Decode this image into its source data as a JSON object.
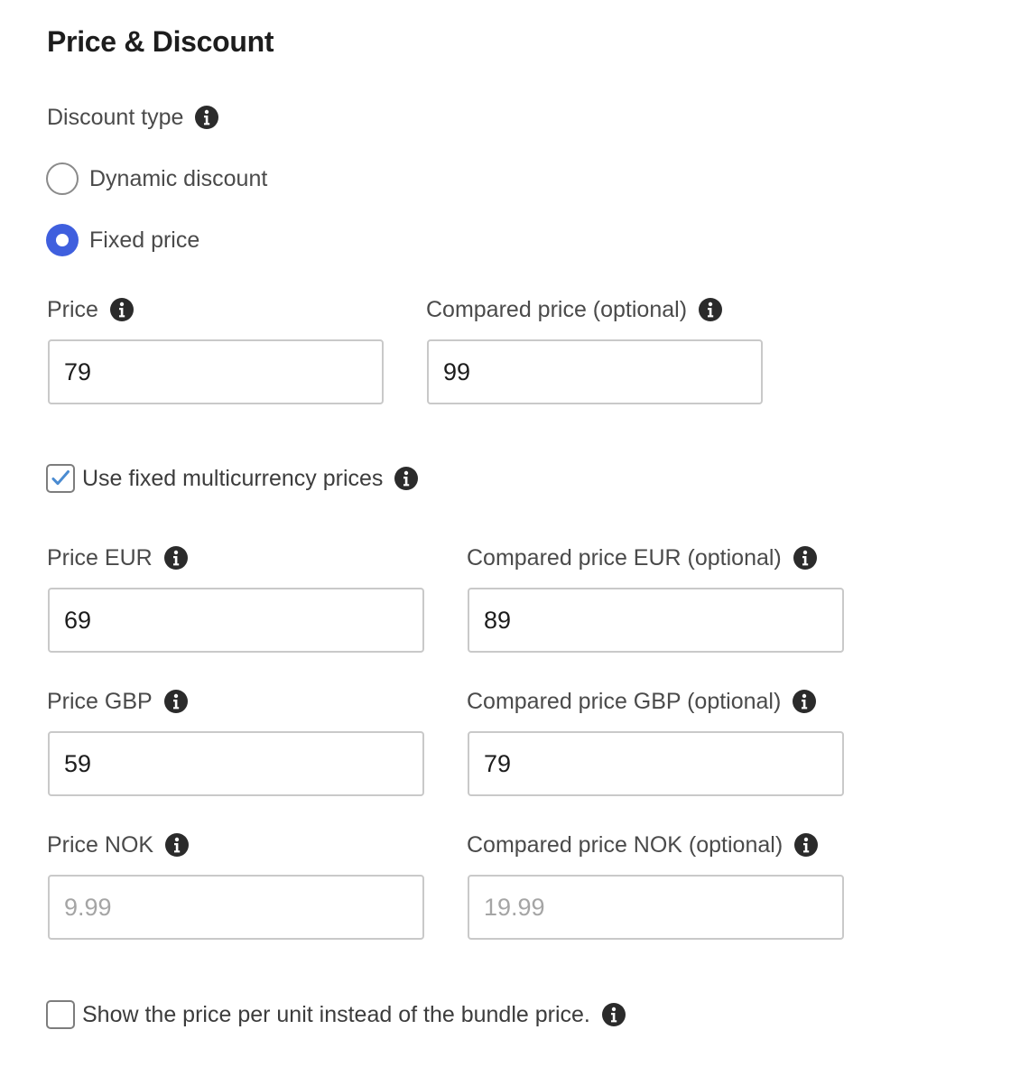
{
  "section": {
    "title": "Price & Discount"
  },
  "discount_type": {
    "label": "Discount type",
    "options": [
      {
        "label": "Dynamic discount",
        "checked": false
      },
      {
        "label": "Fixed price",
        "checked": true
      }
    ]
  },
  "price": {
    "label": "Price",
    "value": "79"
  },
  "compared_price": {
    "label": "Compared price (optional)",
    "value": "99"
  },
  "multicurrency": {
    "label": "Use fixed multicurrency prices",
    "checked": true
  },
  "currencies": [
    {
      "price_label": "Price EUR",
      "price_value": "69",
      "price_placeholder": "",
      "compared_label": "Compared price EUR (optional)",
      "compared_value": "89",
      "compared_placeholder": ""
    },
    {
      "price_label": "Price GBP",
      "price_value": "59",
      "price_placeholder": "",
      "compared_label": "Compared price GBP (optional)",
      "compared_value": "79",
      "compared_placeholder": ""
    },
    {
      "price_label": "Price NOK",
      "price_value": "",
      "price_placeholder": "9.99",
      "compared_label": "Compared price NOK (optional)",
      "compared_value": "",
      "compared_placeholder": "19.99"
    }
  ],
  "unit_price": {
    "label": "Show the price per unit instead of the bundle price.",
    "checked": false
  },
  "icons": {
    "info": "info-icon",
    "check": "checkmark-icon"
  },
  "colors": {
    "accent": "#3f5fde",
    "checkmark": "#4a8bd1",
    "text": "#3c3c3c",
    "border": "#c9c9c9"
  }
}
